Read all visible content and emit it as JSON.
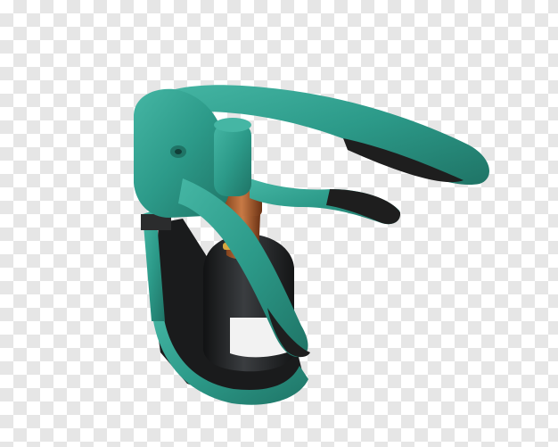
{
  "image": {
    "subject": "lever-corkscrew-on-wine-bottle",
    "background": "transparency-checkerboard",
    "colors": {
      "teal": "#2c9a89",
      "teal_dark": "#1f7466",
      "teal_light": "#45b6a4",
      "grip_black": "#1e1e1e",
      "bottle": "#222426",
      "copper": "#b8632f",
      "gold_band": "#d6a640",
      "label": "#f2f2f2"
    }
  }
}
